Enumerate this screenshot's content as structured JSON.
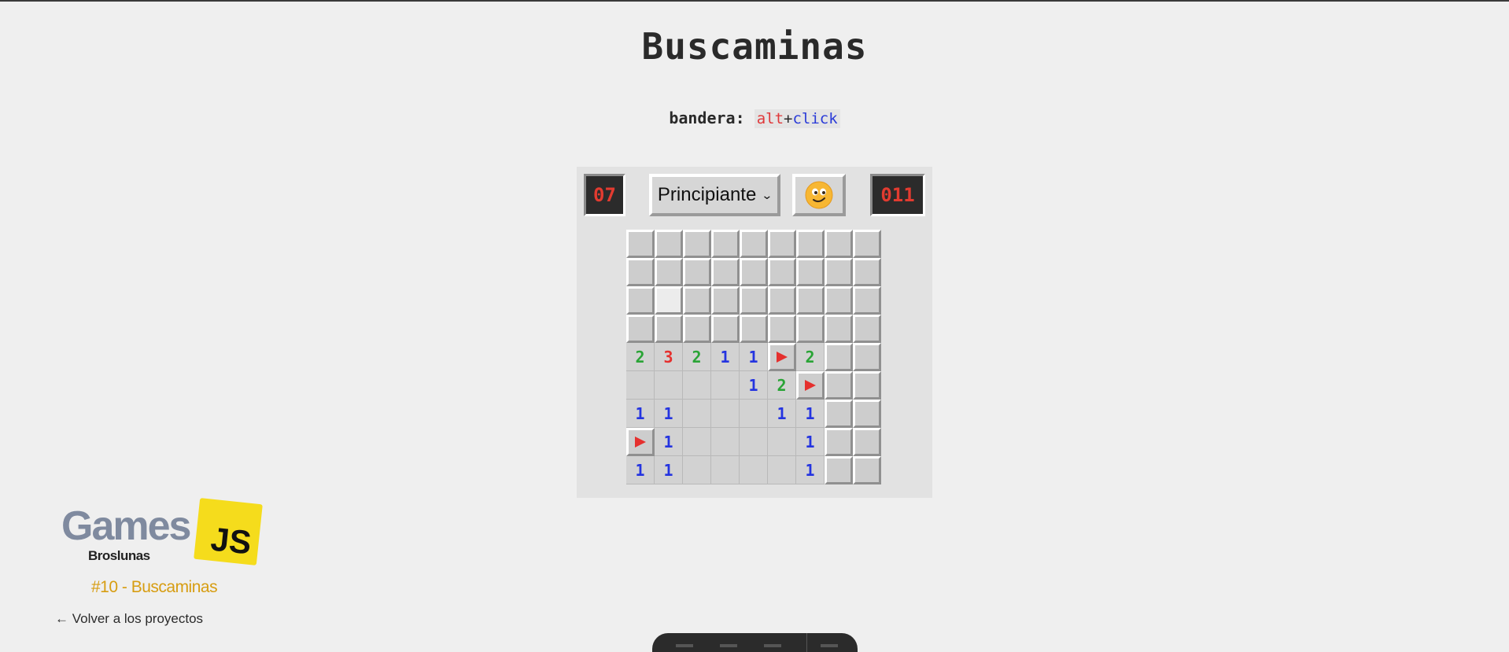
{
  "title": "Buscaminas",
  "hint": {
    "label": "bandera:",
    "key_alt": "alt",
    "key_plus": "+",
    "key_click": "click"
  },
  "game": {
    "mines_left": "07",
    "level": "Principiante",
    "face": "smiley-face",
    "timer": "011",
    "rows": [
      [
        {
          "s": "h"
        },
        {
          "s": "h"
        },
        {
          "s": "h"
        },
        {
          "s": "h"
        },
        {
          "s": "h"
        },
        {
          "s": "h"
        },
        {
          "s": "h"
        },
        {
          "s": "h"
        },
        {
          "s": "h"
        }
      ],
      [
        {
          "s": "h"
        },
        {
          "s": "h"
        },
        {
          "s": "h"
        },
        {
          "s": "h"
        },
        {
          "s": "h"
        },
        {
          "s": "h"
        },
        {
          "s": "h"
        },
        {
          "s": "h"
        },
        {
          "s": "h"
        }
      ],
      [
        {
          "s": "h"
        },
        {
          "s": "hl"
        },
        {
          "s": "h"
        },
        {
          "s": "h"
        },
        {
          "s": "h"
        },
        {
          "s": "h"
        },
        {
          "s": "h"
        },
        {
          "s": "h"
        },
        {
          "s": "h"
        }
      ],
      [
        {
          "s": "h"
        },
        {
          "s": "h"
        },
        {
          "s": "h"
        },
        {
          "s": "h"
        },
        {
          "s": "h"
        },
        {
          "s": "h"
        },
        {
          "s": "h"
        },
        {
          "s": "h"
        },
        {
          "s": "h"
        }
      ],
      [
        {
          "s": "o",
          "v": "2"
        },
        {
          "s": "o",
          "v": "3"
        },
        {
          "s": "o",
          "v": "2"
        },
        {
          "s": "o",
          "v": "1"
        },
        {
          "s": "o",
          "v": "1"
        },
        {
          "s": "f"
        },
        {
          "s": "o",
          "v": "2"
        },
        {
          "s": "h"
        },
        {
          "s": "h"
        }
      ],
      [
        {
          "s": "o"
        },
        {
          "s": "o"
        },
        {
          "s": "o"
        },
        {
          "s": "o"
        },
        {
          "s": "o",
          "v": "1"
        },
        {
          "s": "o",
          "v": "2"
        },
        {
          "s": "f"
        },
        {
          "s": "h"
        },
        {
          "s": "h"
        }
      ],
      [
        {
          "s": "o",
          "v": "1"
        },
        {
          "s": "o",
          "v": "1"
        },
        {
          "s": "o"
        },
        {
          "s": "o"
        },
        {
          "s": "o"
        },
        {
          "s": "o",
          "v": "1"
        },
        {
          "s": "o",
          "v": "1"
        },
        {
          "s": "h"
        },
        {
          "s": "h"
        }
      ],
      [
        {
          "s": "f"
        },
        {
          "s": "o",
          "v": "1"
        },
        {
          "s": "o"
        },
        {
          "s": "o"
        },
        {
          "s": "o"
        },
        {
          "s": "o"
        },
        {
          "s": "o",
          "v": "1"
        },
        {
          "s": "h"
        },
        {
          "s": "h"
        }
      ],
      [
        {
          "s": "o",
          "v": "1"
        },
        {
          "s": "o",
          "v": "1"
        },
        {
          "s": "o"
        },
        {
          "s": "o"
        },
        {
          "s": "o"
        },
        {
          "s": "o"
        },
        {
          "s": "o",
          "v": "1"
        },
        {
          "s": "h"
        },
        {
          "s": "h"
        }
      ]
    ]
  },
  "logo": {
    "word": "Games",
    "badge": "JS",
    "author": "Broslunas"
  },
  "project_label": "#10 - Buscaminas",
  "back_link": "← Volver a los proyectos",
  "colors": {
    "one": "#2434e0",
    "two": "#2aa436",
    "three": "#e5302e",
    "flag": "#e5302e",
    "counter": "#e23b30"
  }
}
